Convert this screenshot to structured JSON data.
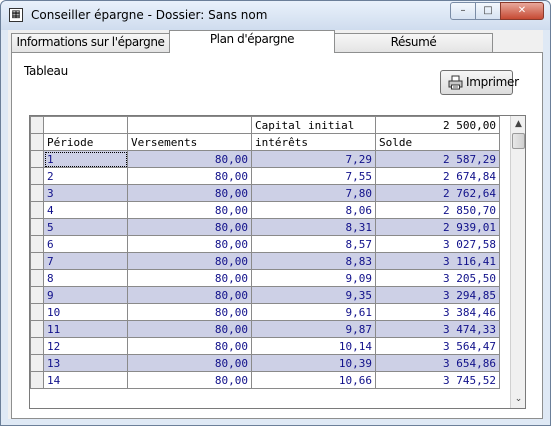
{
  "window": {
    "title": "Conseiller épargne - Dossier: Sans nom",
    "minimize": "–",
    "maximize": "□",
    "close": "✕"
  },
  "tabs": [
    {
      "label": "Informations sur l'épargne",
      "active": false
    },
    {
      "label": "Plan d'épargne",
      "active": true
    },
    {
      "label": "Résumé",
      "active": false
    }
  ],
  "panel": {
    "section_label": "Tableau",
    "print_label": "Imprimer",
    "print_icon": "printer-icon"
  },
  "grid": {
    "initial_capital_label": "Capital initial",
    "initial_capital_value": "2 500,00",
    "headers": [
      "Période",
      "Versements",
      "intérêts",
      "Solde"
    ],
    "rows": [
      [
        "1",
        "80,00",
        "7,29",
        "2 587,29"
      ],
      [
        "2",
        "80,00",
        "7,55",
        "2 674,84"
      ],
      [
        "3",
        "80,00",
        "7,80",
        "2 762,64"
      ],
      [
        "4",
        "80,00",
        "8,06",
        "2 850,70"
      ],
      [
        "5",
        "80,00",
        "8,31",
        "2 939,01"
      ],
      [
        "6",
        "80,00",
        "8,57",
        "3 027,58"
      ],
      [
        "7",
        "80,00",
        "8,83",
        "3 116,41"
      ],
      [
        "8",
        "80,00",
        "9,09",
        "3 205,50"
      ],
      [
        "9",
        "80,00",
        "9,35",
        "3 294,85"
      ],
      [
        "10",
        "80,00",
        "9,61",
        "3 384,46"
      ],
      [
        "11",
        "80,00",
        "9,87",
        "3 474,33"
      ],
      [
        "12",
        "80,00",
        "10,14",
        "3 564,47"
      ],
      [
        "13",
        "80,00",
        "10,39",
        "3 654,86"
      ],
      [
        "14",
        "80,00",
        "10,66",
        "3 745,52"
      ]
    ],
    "scroll_up": "▲",
    "scroll_down": "⌄"
  },
  "colors": {
    "row_stripe": "#cdd0e6",
    "cell_text": "#10108a"
  }
}
